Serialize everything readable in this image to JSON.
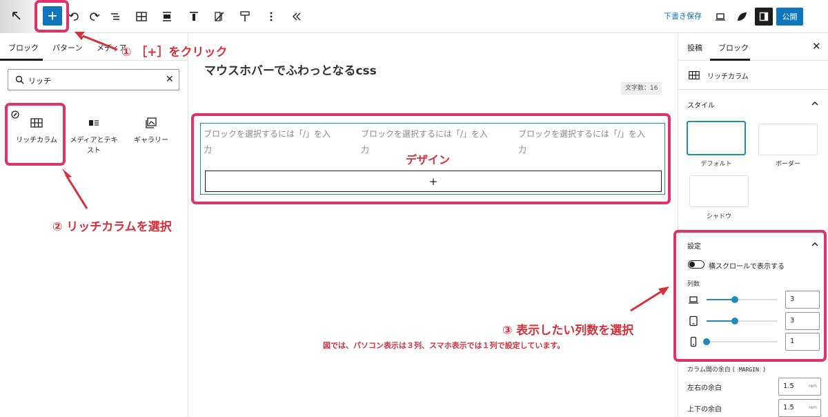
{
  "toolbar": {
    "draft_save": "下書き保存",
    "publish": "公開",
    "add_icon": "plus-icon"
  },
  "inserter": {
    "tabs": [
      "ブロック",
      "パターン",
      "メディア"
    ],
    "search_value": "リッチ",
    "blocks": [
      {
        "label": "リッチカラム",
        "icon": "grid-icon"
      },
      {
        "label": "メディアとテキスト",
        "icon": "media-text-icon"
      },
      {
        "label": "ギャラリー",
        "icon": "gallery-icon"
      }
    ]
  },
  "editor": {
    "title": "マウスホバーでふわっとなるcss",
    "char_count": "文字数：16",
    "column_placeholder": "ブロックを選択するには「/」を入力",
    "appender": "+"
  },
  "sidebar": {
    "tabs": [
      "投稿",
      "ブロック"
    ],
    "block_name": "リッチカラム",
    "style_title": "スタイル",
    "styles": [
      "デフォルト",
      "ボーダー",
      "シャドウ"
    ],
    "settings_title": "設定",
    "scroll_toggle": "横スクロールで表示する",
    "columns_label": "列数",
    "columns": [
      {
        "device": "laptop-icon",
        "value": "3",
        "max": 6
      },
      {
        "device": "tablet-icon",
        "value": "3",
        "max": 6
      },
      {
        "device": "phone-icon",
        "value": "1",
        "max": 6
      }
    ],
    "margin_label": "カラム間の余白 (",
    "margin_code": "MARGIN",
    "margin_close": ")",
    "margins": [
      {
        "label": "左右の余白",
        "value": "1.5",
        "unit": "rem"
      },
      {
        "label": "上下の余白",
        "value": "1.5",
        "unit": "rem"
      }
    ]
  },
  "annotations": {
    "step1": "① ［+］をクリック",
    "step2": "② リッチカラムを選択",
    "step3": "③ 表示したい列数を選択",
    "step3_note": "図では、パソコン表示は３列、スマホ表示では１列で設定しています。",
    "design": "デザイン",
    "color": "#d8303a",
    "highlight": "#e0336a"
  }
}
